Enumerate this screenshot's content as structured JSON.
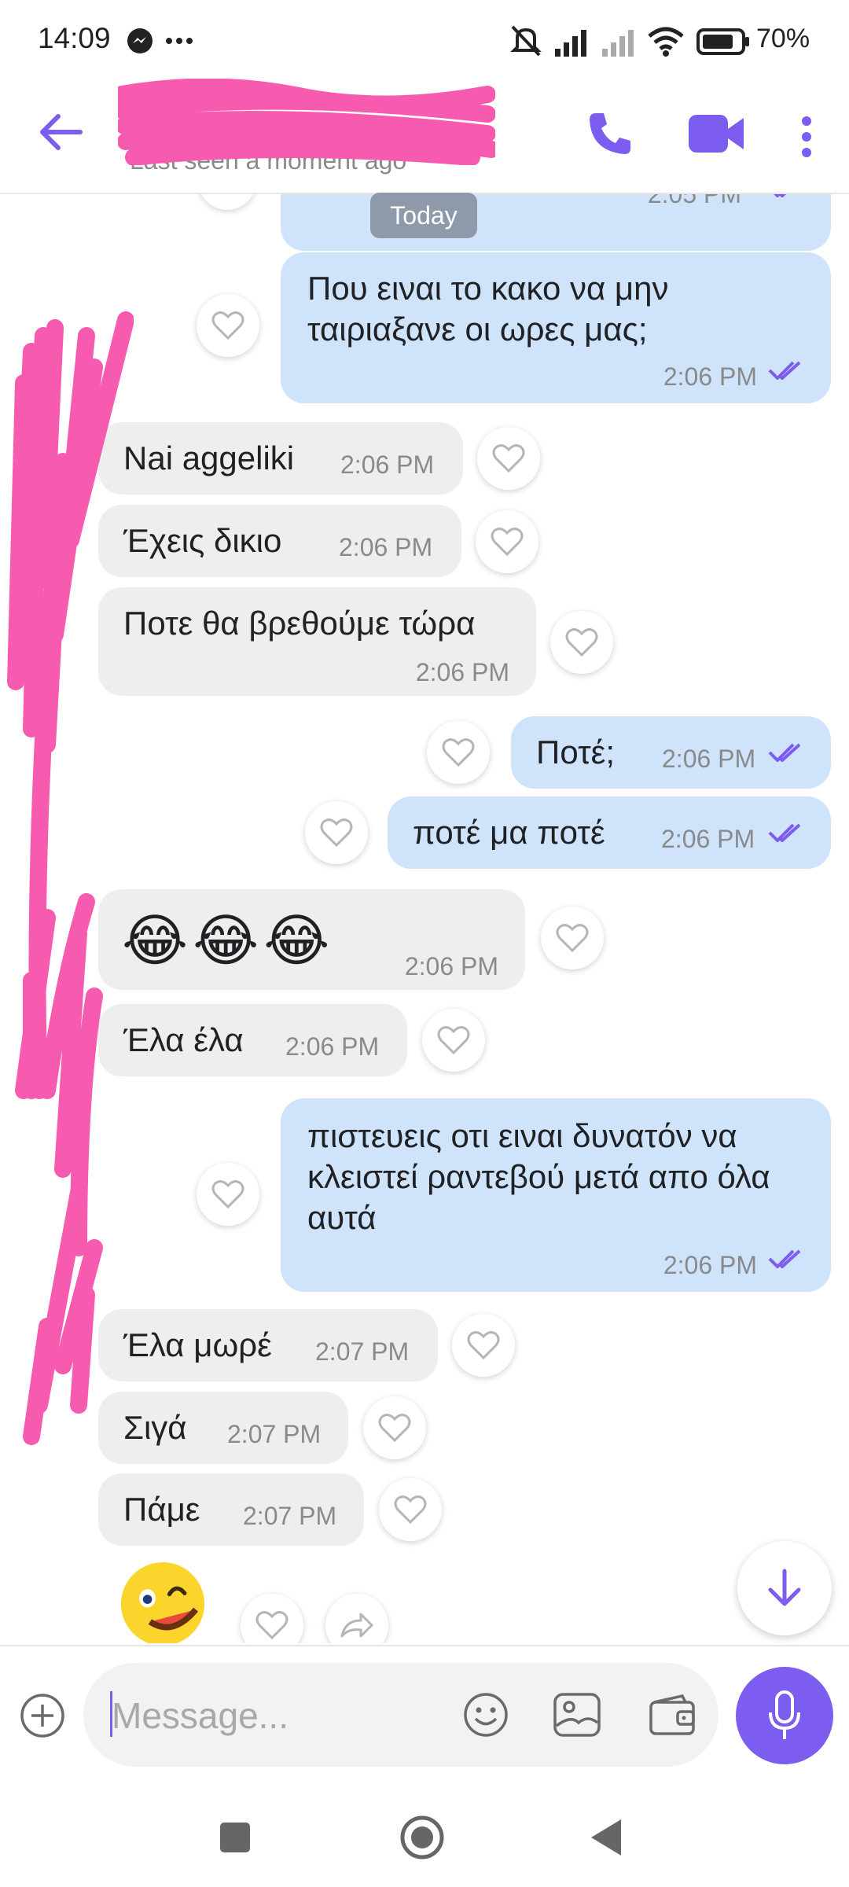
{
  "status_bar": {
    "time": "14:09",
    "battery": "70%"
  },
  "header": {
    "subtitle": "Last seen a moment ago"
  },
  "chat": {
    "date_divider": "Today",
    "messages": [
      {
        "dir": "out",
        "time": "2:05 PM",
        "text": ""
      },
      {
        "dir": "out",
        "text": "Που ειναι το κακο να μην ταιριαξανε οι ωρες μας;",
        "time": "2:06 PM"
      },
      {
        "dir": "in",
        "text": "Nai aggeliki",
        "time": "2:06 PM"
      },
      {
        "dir": "in",
        "text": "Έχεις δικιο",
        "time": "2:06 PM"
      },
      {
        "dir": "in",
        "text": "Ποτε θα βρεθούμε τώρα",
        "time": "2:06 PM"
      },
      {
        "dir": "out",
        "text": "Ποτέ;",
        "time": "2:06 PM"
      },
      {
        "dir": "out",
        "text": "ποτέ μα ποτέ",
        "time": "2:06 PM"
      },
      {
        "dir": "in",
        "text": "😂😂😂",
        "time": "2:06 PM"
      },
      {
        "dir": "in",
        "text": "Έλα έλα",
        "time": "2:06 PM"
      },
      {
        "dir": "out",
        "text": "πιστευεις οτι ειναι δυνατόν να κλειστεί ραντεβού μετά απο όλα αυτά",
        "time": "2:06 PM"
      },
      {
        "dir": "in",
        "text": "Έλα μωρέ",
        "time": "2:07 PM"
      },
      {
        "dir": "in",
        "text": "Σιγά",
        "time": "2:07 PM"
      },
      {
        "dir": "in",
        "text": "Πάμε",
        "time": "2:07 PM"
      }
    ]
  },
  "input": {
    "placeholder": "Message..."
  },
  "colors": {
    "accent": "#7d5cf0",
    "incoming_bubble": "#eeeeee",
    "outgoing_bubble": "#cfe3fb",
    "redaction": "#f75bb0"
  },
  "icons": [
    "back-arrow-icon",
    "phone-icon",
    "video-call-icon",
    "more-vert-icon",
    "heart-icon",
    "double-check-icon",
    "scroll-down-icon",
    "add-icon",
    "emoji-icon",
    "gallery-icon",
    "wallet-icon",
    "mic-icon",
    "recents-icon",
    "home-icon",
    "back-icon",
    "share-icon"
  ]
}
